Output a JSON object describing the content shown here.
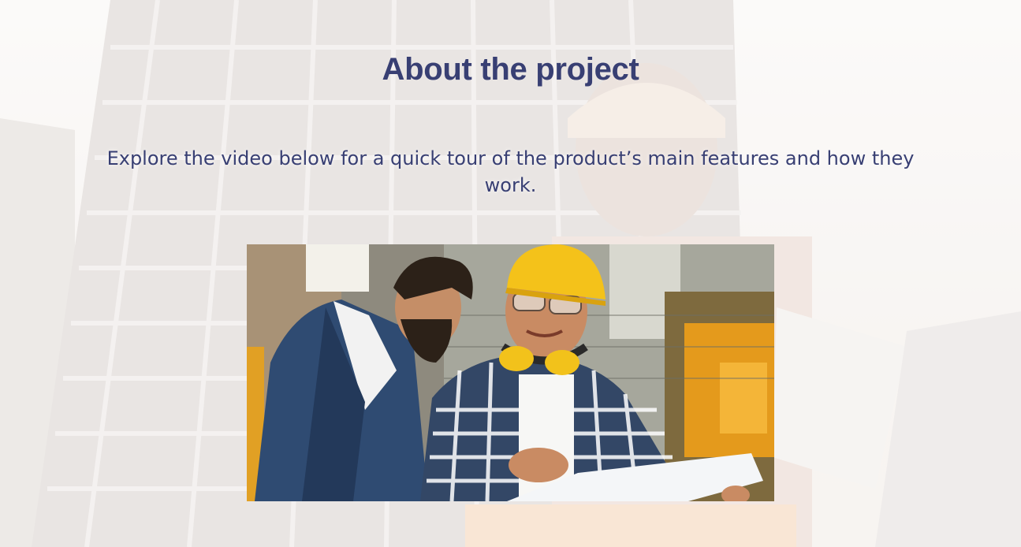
{
  "section": {
    "title": "About the project",
    "description": "Explore the video below for a quick tour of the product’s main features and how they work."
  },
  "video": {
    "thumbnail_subject": "two-workers-reviewing-blueprint"
  },
  "colors": {
    "heading": "#383f73",
    "text": "#383f73",
    "hardhat": "#f4c21a",
    "suit": "#2f4b72"
  }
}
